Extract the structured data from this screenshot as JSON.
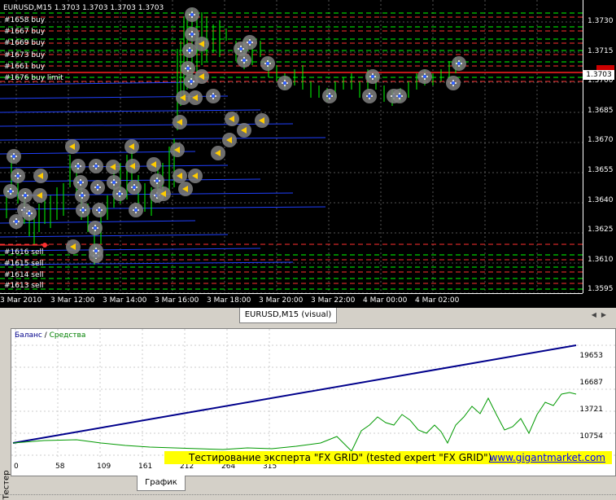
{
  "chart": {
    "title": "EURUSD,M15  1.3703 1.3703 1.3703 1.3703",
    "current_price": "1.3703",
    "price_labels": [
      "1.3730",
      "1.3715",
      "1.3700",
      "1.3685",
      "1.3670",
      "1.3655",
      "1.3640",
      "1.3625",
      "1.3610",
      "1.3595"
    ],
    "time_labels": [
      "3 Mar 2010",
      "3 Mar 12:00",
      "3 Mar 14:00",
      "3 Mar 16:00",
      "3 Mar 18:00",
      "3 Mar 20:00",
      "3 Mar 22:00",
      "4 Mar 00:00",
      "4 Mar 02:00"
    ],
    "buy_orders": [
      "#1658 buy",
      "#1667 buy",
      "#1669 buy",
      "#1673 buy",
      "#1661 buy",
      "#1676 buy limit"
    ],
    "sell_orders": [
      "#1616 sell",
      "#1615 sell",
      "#1614 sell",
      "#1613 sell"
    ],
    "colors": {
      "background": "#000000",
      "buy_line": "#00ff00",
      "sell_line": "#ff0000",
      "trade_line": "#2040ff",
      "candle": "#00ff00",
      "marker": "#808080",
      "arrow": "#ffcc00"
    }
  },
  "tabs": {
    "active": "EURUSD,M15 (visual)"
  },
  "report": {
    "legend_balance": "Баланс",
    "legend_separator": "/",
    "legend_equity": "Средства",
    "y_labels": [
      "19653",
      "16687",
      "13721",
      "10754"
    ],
    "x_labels": [
      "0",
      "58",
      "109",
      "161",
      "212",
      "264",
      "315"
    ],
    "banner_text": "Тестирование эксперта \"FX GRID\" (tested expert \"FX GRID\")",
    "banner_link": "www.gigantmarket.com",
    "bottom_tab": "График",
    "side_tab": "Тестер",
    "colors": {
      "balance": "#00008b",
      "equity": "#009900",
      "banner": "#ffff00"
    }
  }
}
